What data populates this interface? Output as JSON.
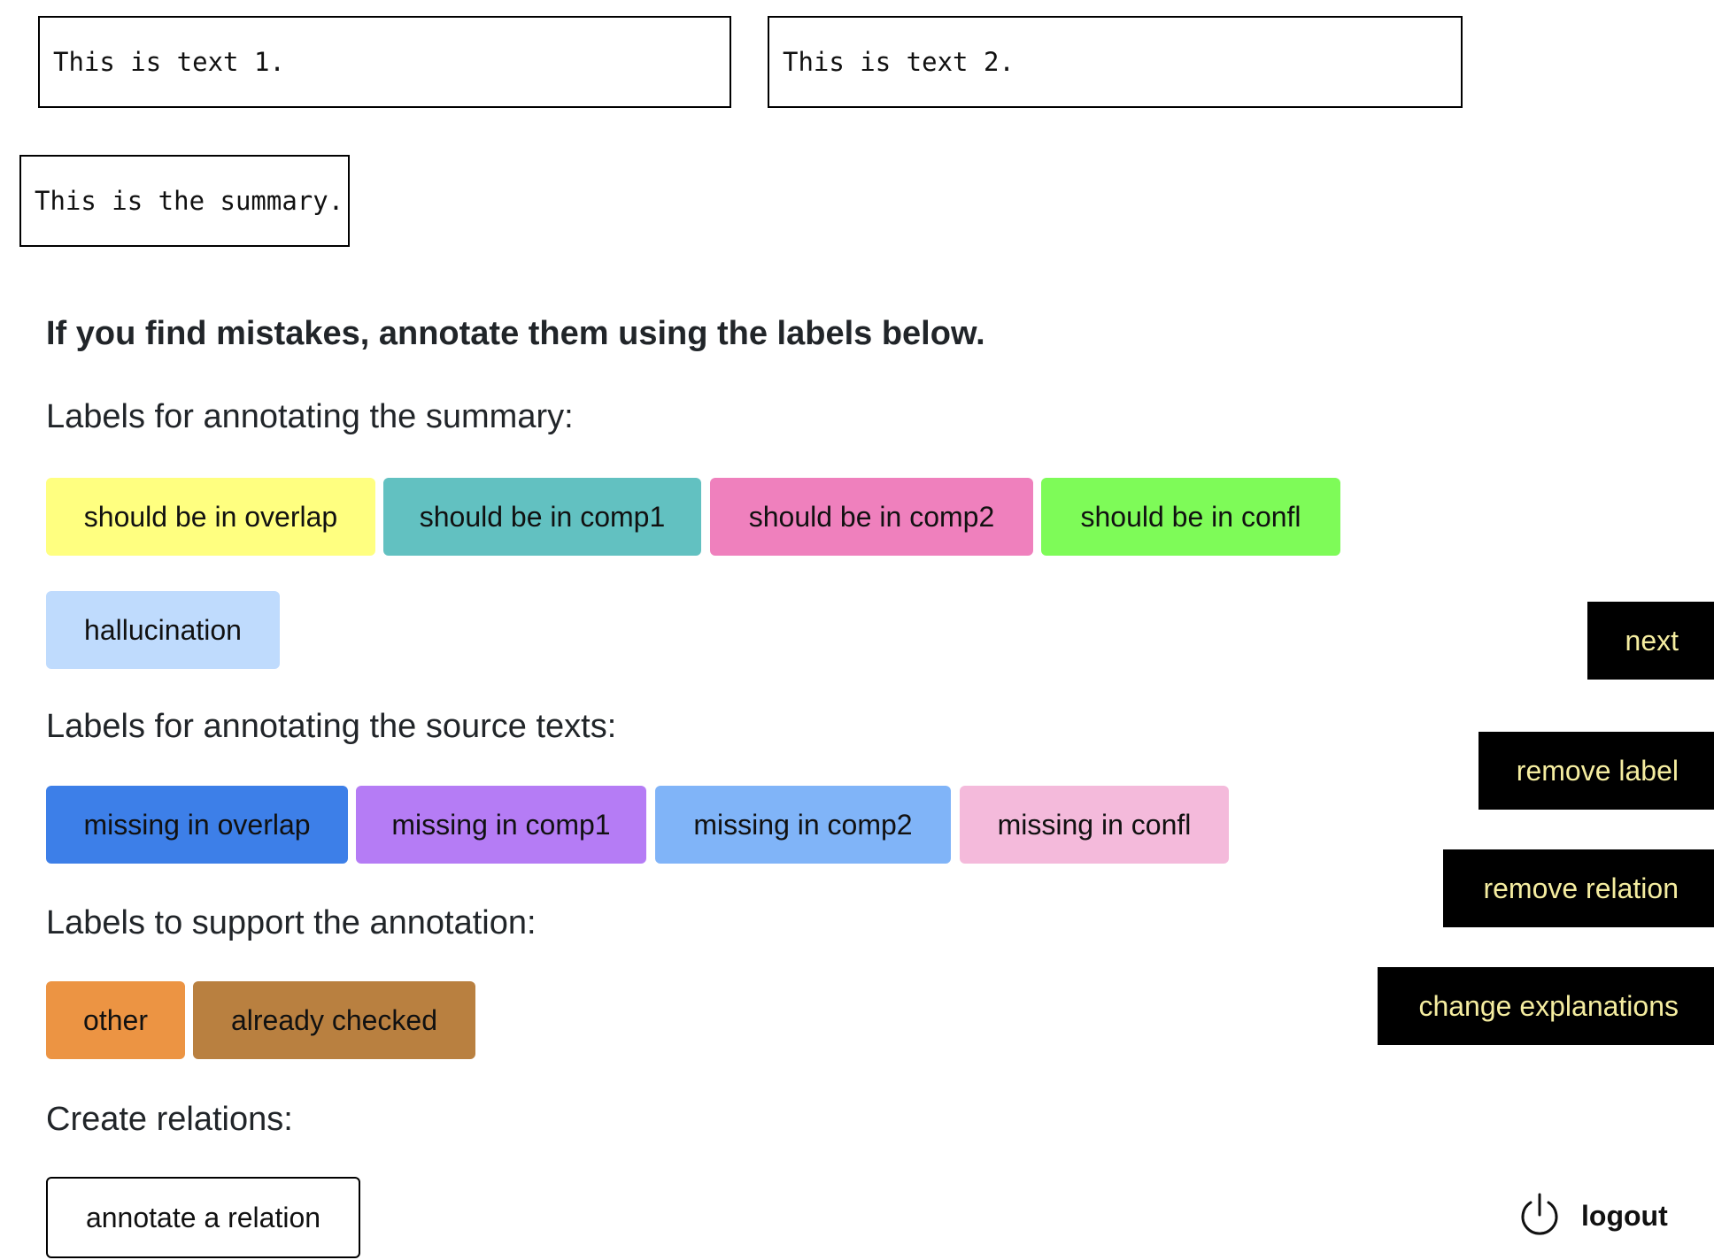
{
  "texts": {
    "text1": "This is text 1.",
    "text2": "This is text 2.",
    "summary": "This is the summary."
  },
  "instruction": "If you find mistakes, annotate them using the labels below.",
  "sections": {
    "summary_labels_heading": "Labels for annotating the summary:",
    "source_labels_heading": "Labels for annotating the source texts:",
    "support_labels_heading": "Labels to support the annotation:",
    "relations_heading": "Create relations:"
  },
  "summary_labels": [
    {
      "label": "should be in overlap",
      "color": "#ffff80"
    },
    {
      "label": "should be in comp1",
      "color": "#62c1c1"
    },
    {
      "label": "should be in comp2",
      "color": "#ef80bd"
    },
    {
      "label": "should be in confl",
      "color": "#7efb58"
    },
    {
      "label": "hallucination",
      "color": "#bfdbfd"
    }
  ],
  "source_labels": [
    {
      "label": "missing in overlap",
      "color": "#3d7fe8"
    },
    {
      "label": "missing in comp1",
      "color": "#b57cf5"
    },
    {
      "label": "missing in comp2",
      "color": "#80b4f8"
    },
    {
      "label": "missing in confl",
      "color": "#f4badb"
    }
  ],
  "support_labels": [
    {
      "label": "other",
      "color": "#ec9443"
    },
    {
      "label": "already checked",
      "color": "#b98040"
    }
  ],
  "relations": {
    "annotate_label": "annotate a relation"
  },
  "side_buttons": {
    "next": "next",
    "remove_label": "remove label",
    "remove_relation": "remove relation",
    "change_explanations": "change explanations"
  },
  "logout": {
    "label": "logout",
    "icon": "power-icon"
  }
}
